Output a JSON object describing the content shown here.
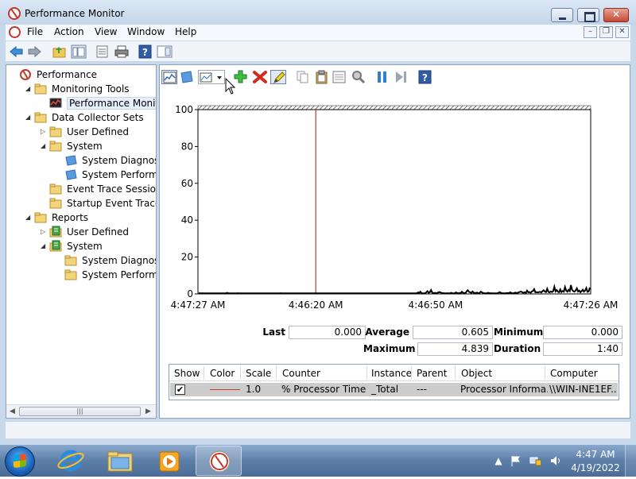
{
  "window": {
    "title": "Performance Monitor"
  },
  "menu": {
    "items": [
      "File",
      "Action",
      "View",
      "Window",
      "Help"
    ]
  },
  "tree": {
    "items": [
      {
        "label": "Performance",
        "level": 0,
        "twisty": "",
        "icon": "perfmon-icon"
      },
      {
        "label": "Monitoring Tools",
        "level": 1,
        "twisty": "expanded",
        "icon": "folder-icon"
      },
      {
        "label": "Performance Monitor",
        "level": 2,
        "twisty": "",
        "icon": "chart-icon",
        "selected": true
      },
      {
        "label": "Data Collector Sets",
        "level": 1,
        "twisty": "expanded",
        "icon": "folder-icon"
      },
      {
        "label": "User Defined",
        "level": 2,
        "twisty": "collapsed",
        "icon": "folder-icon"
      },
      {
        "label": "System",
        "level": 2,
        "twisty": "expanded",
        "icon": "folder-icon"
      },
      {
        "label": "System Diagnostics",
        "level": 3,
        "twisty": "",
        "icon": "collector-icon"
      },
      {
        "label": "System Performanc",
        "level": 3,
        "twisty": "",
        "icon": "collector-icon"
      },
      {
        "label": "Event Trace Sessions",
        "level": 2,
        "twisty": "",
        "icon": "folder-icon"
      },
      {
        "label": "Startup Event Trace Ses",
        "level": 2,
        "twisty": "",
        "icon": "folder-icon"
      },
      {
        "label": "Reports",
        "level": 1,
        "twisty": "expanded",
        "icon": "folder-icon"
      },
      {
        "label": "User Defined",
        "level": 2,
        "twisty": "collapsed",
        "icon": "report-icon"
      },
      {
        "label": "System",
        "level": 2,
        "twisty": "expanded",
        "icon": "report-icon"
      },
      {
        "label": "System Diagnostics",
        "level": 3,
        "twisty": "",
        "icon": "folder-icon"
      },
      {
        "label": "System Performanc",
        "level": 3,
        "twisty": "",
        "icon": "folder-icon"
      }
    ]
  },
  "chart_data": {
    "type": "line",
    "ylim": [
      0,
      100
    ],
    "yticks": [
      0,
      20,
      40,
      60,
      80,
      100
    ],
    "xticks": [
      "4:47:27 AM",
      "4:46:20 AM",
      "4:46:50 AM",
      "4:47:26 AM"
    ],
    "time_bar_position": 0.3,
    "series": [
      {
        "color": "#000000",
        "values": [
          0.6,
          0.3,
          0.2,
          0.4,
          0.1,
          0.2,
          0.3,
          0.1,
          0.2,
          0.2,
          0.1,
          0.3,
          0.2,
          0.1,
          0.2,
          0.2,
          0.3,
          0.1,
          0.2,
          0.2,
          0.1,
          0.2,
          0.3,
          0.2,
          0.6,
          0.1,
          0.2,
          0.1,
          0.2,
          0.3,
          0.2,
          0.1,
          0.2,
          0.4,
          0.2,
          0.1,
          0.2,
          0.3,
          0.1,
          0.2,
          0.1,
          0.2,
          0.3,
          0.2,
          0.1,
          0.2,
          0.1,
          0.3,
          0.2,
          0.2,
          0.1,
          0.2,
          0.1,
          0.2,
          0.3,
          0.2,
          0.1,
          0.2,
          0.3,
          0.1,
          0.2,
          0.2,
          0.1,
          0.2,
          0.1,
          0.2,
          0.3,
          0.2,
          0.1,
          0.4,
          0.2,
          0.1,
          0.2,
          0.3,
          0.1,
          0.2,
          0.2,
          0.1,
          0.2,
          0.3,
          0.2,
          0.1,
          0.2,
          0.1,
          0.2,
          0.3,
          0.2,
          0.1,
          0.2,
          0.2,
          0.1,
          0.3,
          0.2,
          0.1,
          0.2,
          0.2,
          0.1,
          0.3,
          0.2,
          0.1,
          0.2,
          0.2,
          0.3,
          0.1,
          0.2,
          0.2,
          0.1,
          0.2,
          0.3,
          0.2,
          0.1,
          0.2,
          0.1,
          0.2,
          0.3,
          0.2,
          0.1,
          0.2,
          0.3,
          0.1,
          0.2,
          0.2,
          0.1,
          0.2,
          0.1,
          0.2,
          0.3,
          0.2,
          0.1,
          0.2,
          0.3,
          0.1,
          0.2,
          0.2,
          0.1,
          0.2,
          0.1,
          0.2,
          0.3,
          0.2,
          0.1,
          0.2,
          0.3,
          0.1,
          0.2,
          0.2,
          0.1,
          0.2,
          0.1,
          0.3,
          0.2,
          0.2,
          0.3,
          0.1,
          0.2,
          0.2,
          0.1,
          0.3,
          0.2,
          0.1,
          0.2,
          0.2,
          0.3,
          0.1,
          0.2,
          0.3,
          0.2,
          0.1,
          0.2,
          0.3,
          0.2,
          0.1,
          0.2,
          0.3,
          0.2,
          0.1,
          0.2,
          0.3,
          0.1,
          0.2,
          0.2,
          0.3,
          0.1,
          0.2,
          0.4,
          0.8,
          0.5,
          1.2,
          0.3,
          0.2,
          0.3,
          0.4,
          0.8,
          1.5,
          0.6,
          0.9,
          2.1,
          0.7,
          0.4,
          0.6,
          0.5,
          0.3,
          0.8,
          1.0,
          0.9,
          0.4,
          0.5,
          0.3,
          0.2,
          0.3,
          0.4,
          0.2,
          0.3,
          0.6,
          0.3,
          0.2,
          0.3,
          0.8,
          0.5,
          0.3,
          0.5,
          0.4,
          1.2,
          0.6,
          0.5,
          0.4,
          1.4,
          2.0,
          1.1,
          0.9,
          0.5,
          1.3,
          0.6,
          0.5,
          0.6,
          0.7,
          0.4,
          0.5,
          1.2,
          0.8,
          0.5,
          0.3,
          0.2,
          0.4,
          0.6,
          0.5,
          0.3,
          0.4,
          0.2,
          0.3,
          0.2,
          0.3,
          0.4,
          0.6,
          1.0,
          0.5,
          0.3,
          0.4,
          0.2,
          0.3,
          0.5,
          0.4,
          0.6,
          0.8,
          0.4,
          0.3,
          0.5,
          0.7,
          0.6,
          0.5,
          0.9,
          1.1,
          1.3,
          0.8,
          0.6,
          0.9,
          0.5,
          1.8,
          0.9,
          1.0,
          0.6,
          1.3,
          1.6,
          2.6,
          0.9,
          1.0,
          0.8,
          1.0,
          1.1,
          0.8,
          1.5,
          2.0,
          1.3,
          1.0,
          2.8,
          1.1,
          0.8,
          1.4,
          1.0,
          1.5,
          3.9,
          1.4,
          2.1,
          1.2,
          0.9,
          2.4,
          1.0,
          1.6,
          1.2,
          3.8,
          1.8,
          1.2,
          2.2,
          1.5,
          4.8,
          2.2,
          1.5,
          1.2,
          1.9,
          3.0,
          1.3,
          1.8,
          0.9,
          1.6,
          2.3,
          1.2,
          1.8,
          3.2,
          1.1,
          1.4,
          3.5
        ]
      }
    ]
  },
  "stats": {
    "last_label": "Last",
    "last_value": "0.000",
    "average_label": "Average",
    "average_value": "0.605",
    "minimum_label": "Minimum",
    "minimum_value": "0.000",
    "maximum_label": "Maximum",
    "maximum_value": "4.839",
    "duration_label": "Duration",
    "duration_value": "1:40"
  },
  "legend": {
    "columns": [
      "Show",
      "Color",
      "Scale",
      "Counter",
      "Instance",
      "Parent",
      "Object",
      "Computer"
    ],
    "rows": [
      {
        "show": "✔",
        "color": "#c0392b",
        "scale": "1.0",
        "counter": "% Processor Time",
        "instance": "_Total",
        "parent": "---",
        "object": "Processor Informa...",
        "computer": "\\\\WIN-INE1EF..."
      }
    ]
  },
  "taskbar": {
    "time": "4:47 AM",
    "date": "4/19/2022"
  }
}
